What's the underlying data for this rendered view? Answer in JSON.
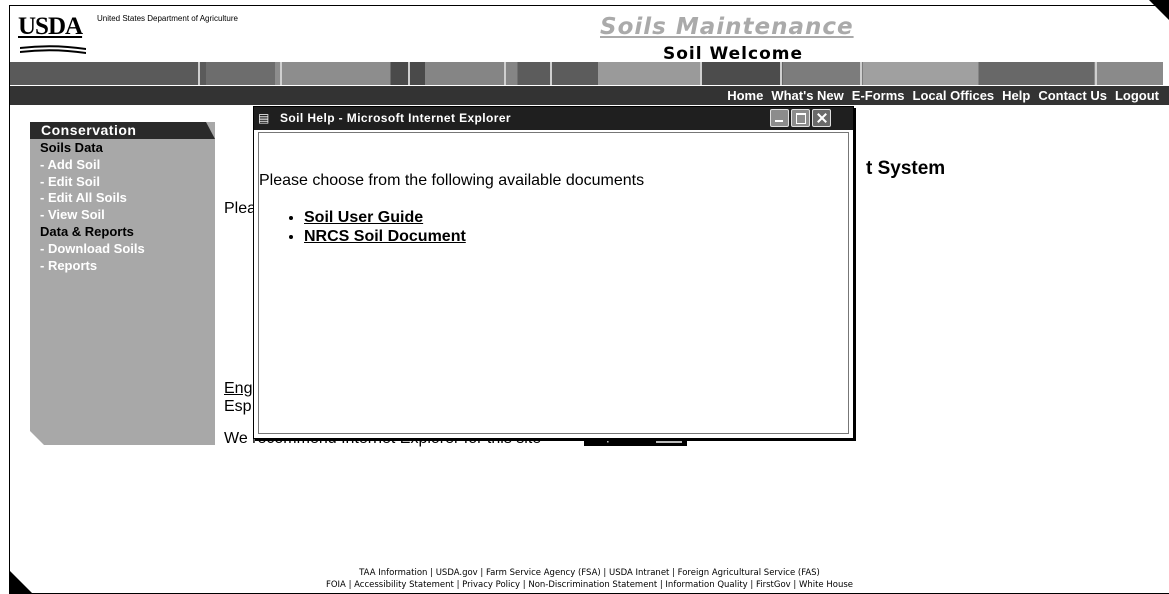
{
  "header": {
    "logo_text": "USDA",
    "agency_name": "United States Department of Agriculture",
    "site_title": "Soils Maintenance",
    "page_title": "Soil Welcome"
  },
  "nav": {
    "links": [
      "Home",
      "What's New",
      "E-Forms",
      "Local Offices",
      "Help",
      "Contact Us",
      "Logout"
    ]
  },
  "sidebar": {
    "header": "Conservation",
    "items": [
      {
        "label": "Soils Data",
        "type": "section"
      },
      {
        "label": " - Add Soil",
        "type": "link"
      },
      {
        "label": " - Edit Soil",
        "type": "link"
      },
      {
        "label": " - Edit All Soils",
        "type": "link"
      },
      {
        "label": " - View Soil",
        "type": "link"
      },
      {
        "label": "Data & Reports",
        "type": "section"
      },
      {
        "label": " - Download Soils",
        "type": "link"
      },
      {
        "label": " - Reports",
        "type": "link"
      }
    ]
  },
  "main": {
    "heading_fragment": "t System",
    "please_fragment": "Plea",
    "lang_english_fragment": "Eng",
    "lang_spanish_fragment": "Esp",
    "recommend_text": "We recommend Internet Explorer for this site",
    "ie_badge_text": "Explorer"
  },
  "popup": {
    "title": "Soil Help - Microsoft Internet Explorer",
    "intro": "Please choose from the following available documents",
    "documents": [
      "Soil User Guide",
      "NRCS Soil Document"
    ]
  },
  "footer": {
    "line1": "TAA Information | USDA.gov | Farm Service Agency (FSA) | USDA Intranet | Foreign Agricultural Service (FAS)",
    "line2": "FOIA | Accessibility Statement | Privacy Policy | Non-Discrimination Statement | Information Quality | FirstGov | White House"
  }
}
